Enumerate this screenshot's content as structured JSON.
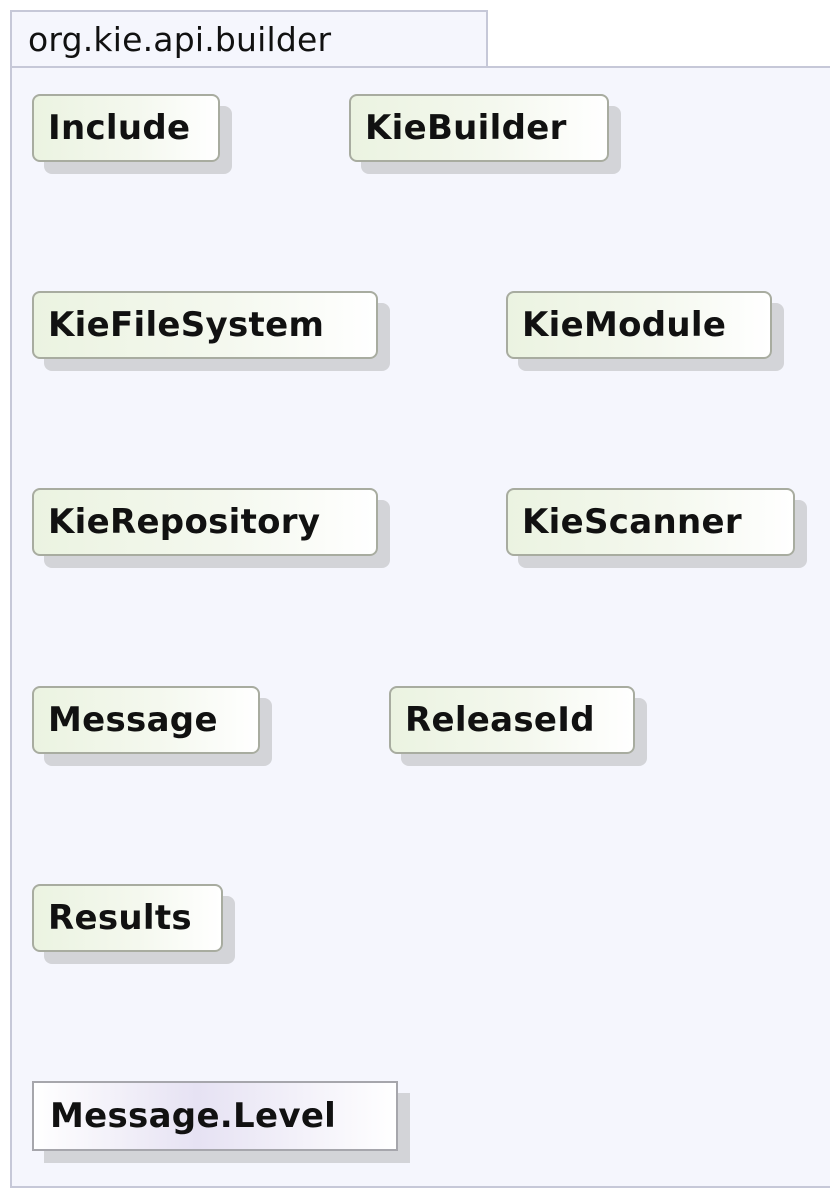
{
  "package": {
    "name": "org.kie.api.builder"
  },
  "classes": {
    "include": "Include",
    "kie_builder": "KieBuilder",
    "kie_file_system": "KieFileSystem",
    "kie_module": "KieModule",
    "kie_repository": "KieRepository",
    "kie_scanner": "KieScanner",
    "message": "Message",
    "release_id": "ReleaseId",
    "results": "Results"
  },
  "enums": {
    "message_level": "Message.Level"
  },
  "colors": {
    "package_fill": "#f5f6fd",
    "package_border": "#c6c8d8",
    "class_fill_start": "#ebf3e1",
    "enum_fill_mid": "#e6e2f3",
    "shadow": "#aaaaaa"
  }
}
